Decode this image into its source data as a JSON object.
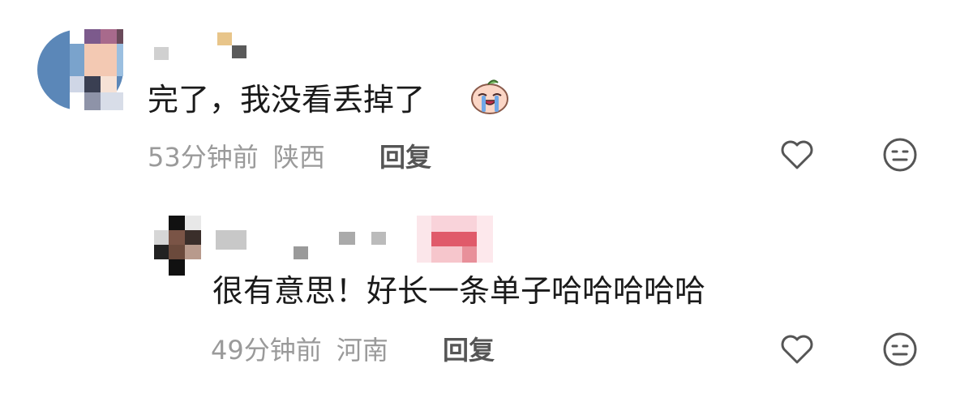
{
  "comments": [
    {
      "text": "完了，我没看丢掉了",
      "time": "53分钟前",
      "location": "陕西",
      "reply_label": "回复",
      "emoji": "crying-face-emoji"
    },
    {
      "text": "很有意思！好长一条单子哈哈哈哈哈",
      "time": "49分钟前",
      "location": "河南",
      "reply_label": "回复"
    }
  ],
  "colors": {
    "text": "#1a1a1a",
    "meta": "#9a9a9a",
    "reply": "#555555",
    "icon": "#555555"
  },
  "icons": [
    "heart-icon",
    "dislike-face-icon"
  ]
}
